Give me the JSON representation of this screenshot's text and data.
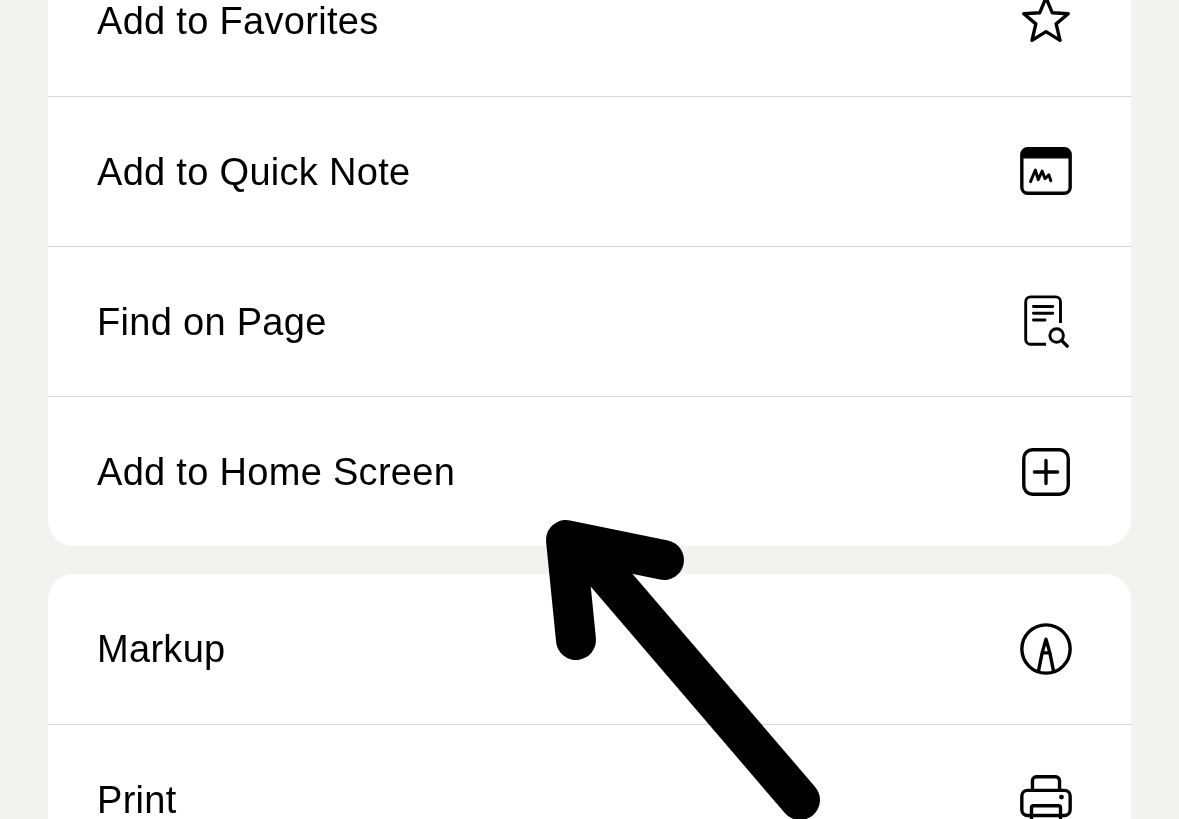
{
  "groups": [
    {
      "items": [
        {
          "label": "Add to Favorites",
          "kind": "star"
        },
        {
          "label": "Add to Quick Note",
          "kind": "quicknote"
        },
        {
          "label": "Find on Page",
          "kind": "find"
        },
        {
          "label": "Add to Home Screen",
          "kind": "addsquare"
        }
      ]
    },
    {
      "items": [
        {
          "label": "Markup",
          "kind": "markup"
        },
        {
          "label": "Print",
          "kind": "print"
        }
      ]
    }
  ]
}
